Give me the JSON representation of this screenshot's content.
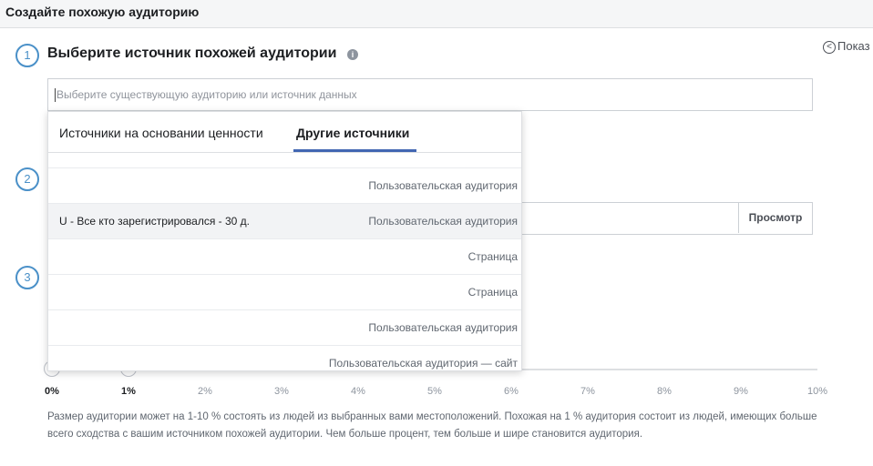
{
  "window": {
    "title": "Создайте похожую аудиторию"
  },
  "steps": {
    "s1": "1",
    "s2": "2",
    "s3": "3"
  },
  "section1": {
    "heading": "Выберите источник похожей аудитории",
    "info_icon": "i",
    "show_link": "Показ",
    "show_icon": "<",
    "search_placeholder": "Выберите существующую аудиторию или источник данных"
  },
  "section2": {
    "preview_label": "Просмотр"
  },
  "dropdown": {
    "tabs": [
      "Источники на основании ценности",
      "Другие источники"
    ],
    "active_tab": 1,
    "rows": [
      {
        "name": "",
        "type": "Пользовательская аудитория"
      },
      {
        "name": "U - Все кто зарегистрировался - 30 д.",
        "type": "Пользовательская аудитория",
        "highlighted": true
      },
      {
        "name": "",
        "type": "Страница"
      },
      {
        "name": "",
        "type": "Страница"
      },
      {
        "name": "",
        "type": "Пользовательская аудитория"
      },
      {
        "name": "",
        "type": "Пользовательская аудитория — сайт"
      }
    ]
  },
  "slider": {
    "ticks": [
      "0%",
      "1%",
      "2%",
      "3%",
      "4%",
      "5%",
      "6%",
      "7%",
      "8%",
      "9%",
      "10%"
    ],
    "selected_min": "0%",
    "selected_max": "1%"
  },
  "help_text": "Размер аудитории может на 1-10 % состоять из людей из выбранных вами местоположений. Похожая на 1 % аудитория состоит из людей, имеющих больше всего сходства с вашим источником похожей аудитории. Чем больше процент, тем больше и шире становится аудитория.",
  "colors": {
    "accent": "#4267b2",
    "step": "#4a90c8",
    "text": "#1c1e21",
    "muted": "#606770"
  },
  "icons": [
    "info-icon",
    "chevron-left-icon"
  ]
}
